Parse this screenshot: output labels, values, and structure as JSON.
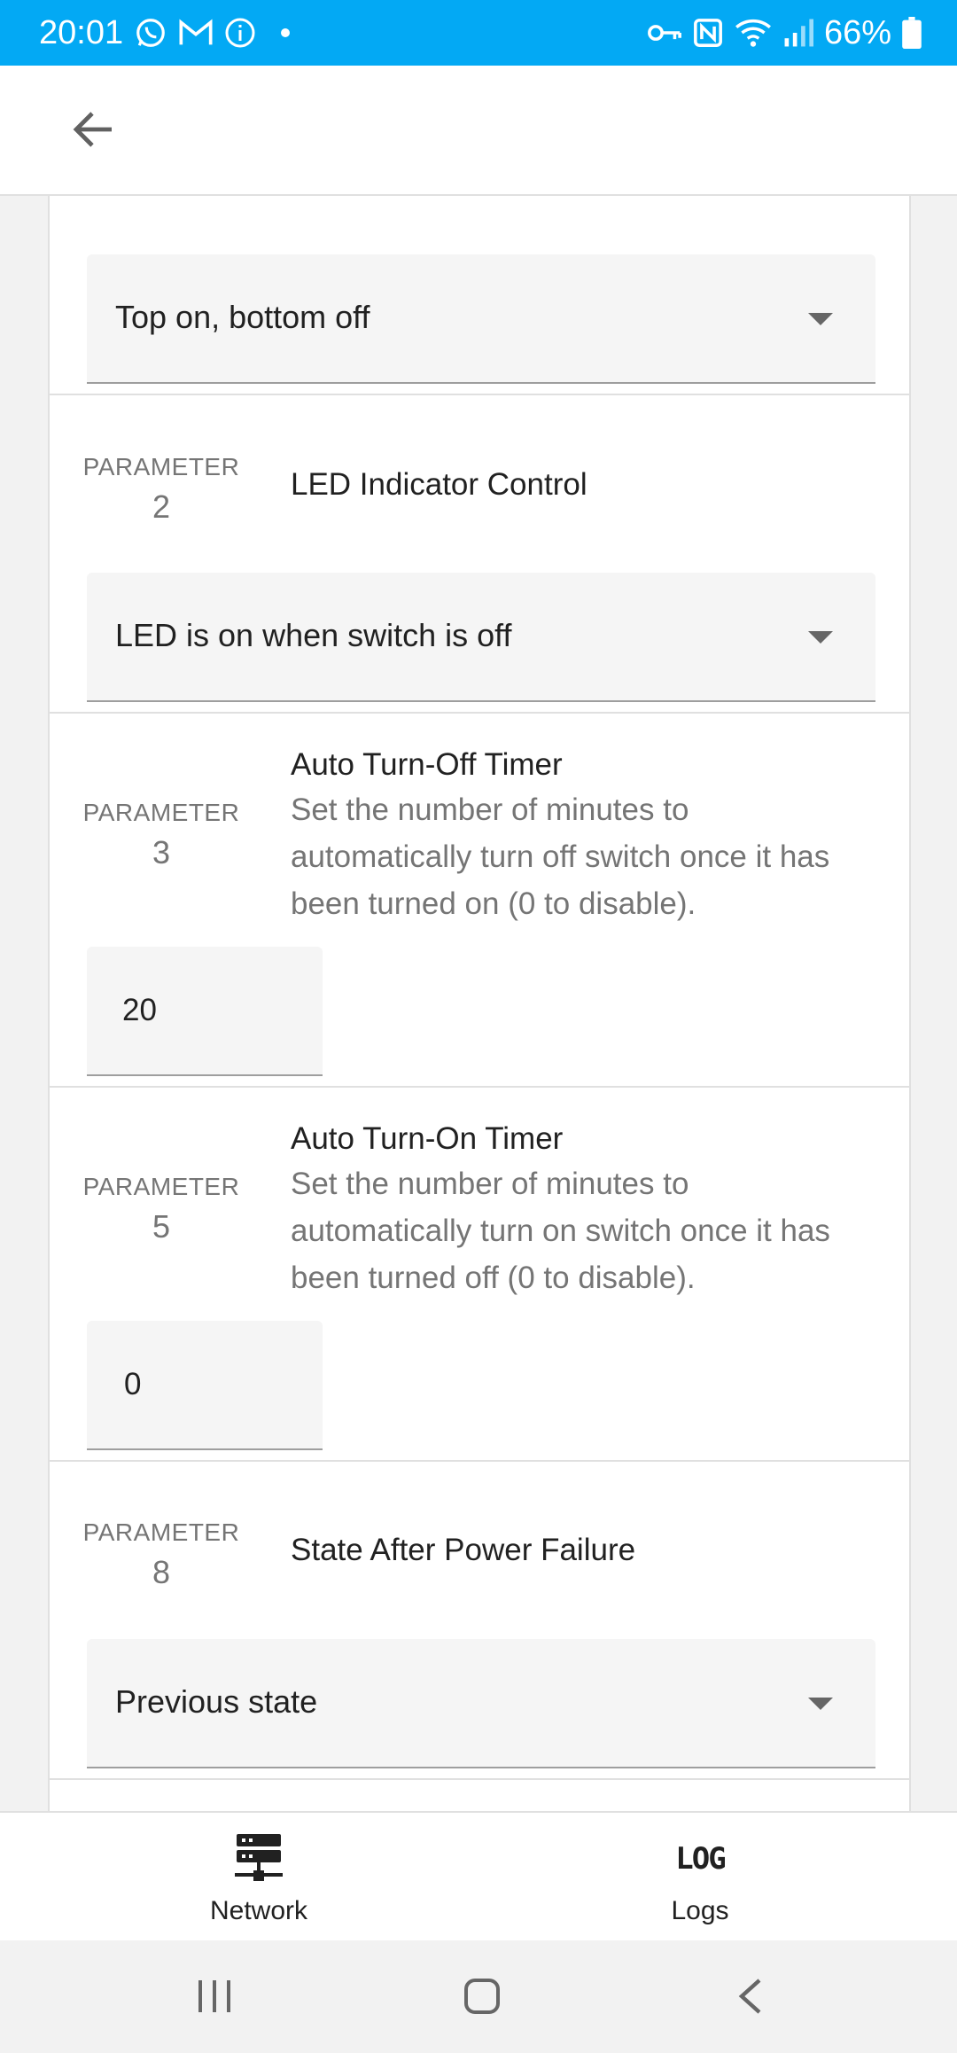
{
  "status_bar": {
    "time": "20:01",
    "battery": "66%",
    "icons_left": [
      "whatsapp-icon",
      "gmail-icon",
      "info-icon",
      "dot-icon"
    ],
    "icons_right": [
      "vpn-key-icon",
      "nfc-icon",
      "wifi-icon",
      "signal-icon",
      "battery-icon"
    ]
  },
  "app_bar": {
    "back_icon": "arrow-back-icon"
  },
  "parameters": [
    {
      "kind": "select",
      "value": "Top on, bottom off"
    },
    {
      "label": "PARAMETER",
      "number": "2",
      "title": "LED Indicator Control",
      "kind": "select",
      "value": "LED is on when switch is off"
    },
    {
      "label": "PARAMETER",
      "number": "3",
      "title": "Auto Turn-Off Timer",
      "description": "Set the number of minutes to automatically turn off switch once it has been turned on (0 to disable).",
      "kind": "number",
      "value": "20"
    },
    {
      "label": "PARAMETER",
      "number": "5",
      "title": "Auto Turn-On Timer",
      "description": "Set the number of minutes to automatically turn on switch once it has been turned off (0 to disable).",
      "kind": "number",
      "value": "0"
    },
    {
      "label": "PARAMETER",
      "number": "8",
      "title": "State After Power Failure",
      "kind": "select",
      "value": "Previous state"
    }
  ],
  "bottom_nav": {
    "network": {
      "label": "Network",
      "icon": "server-network-icon"
    },
    "logs": {
      "label": "Logs",
      "glyph": "LOG",
      "icon": "log-icon"
    }
  },
  "system_nav": [
    "recents-icon",
    "home-icon",
    "back-icon"
  ],
  "colors": {
    "status_bar": "#03a9f4",
    "field_bg": "#f5f5f5",
    "divider": "#e0e0e0",
    "secondary_text": "#757575"
  }
}
